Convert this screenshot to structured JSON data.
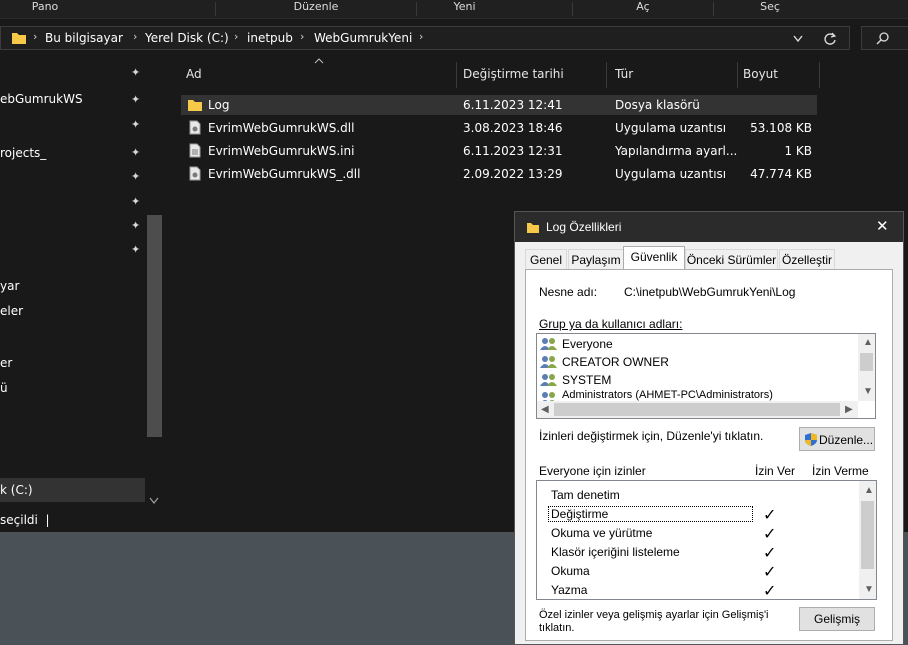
{
  "ribbon": {
    "items": [
      "Pano",
      "Düzenle",
      "Yeni",
      "Aç",
      "Seç"
    ]
  },
  "address": {
    "crumbs": [
      "Bu bilgisayar",
      "Yerel Disk (C:)",
      "inetpub",
      "WebGumrukYeni"
    ]
  },
  "nav": {
    "items": [
      "ebGumrukWS",
      "rojects_",
      "yar",
      "eler",
      "er",
      "ü",
      "k (C:)"
    ]
  },
  "columns": {
    "name": "Ad",
    "date": "Değiştirme tarihi",
    "type": "Tür",
    "size": "Boyut"
  },
  "files": [
    {
      "name": "Log",
      "date": "6.11.2023 12:41",
      "type": "Dosya klasörü",
      "size": "",
      "icon": "folder-icon"
    },
    {
      "name": "EvrimWebGumrukWS.dll",
      "date": "3.08.2023 18:46",
      "type": "Uygulama uzantısı",
      "size": "53.108 KB",
      "icon": "dll-file-icon"
    },
    {
      "name": "EvrimWebGumrukWS.ini",
      "date": "6.11.2023 12:31",
      "type": "Yapılandırma ayarl...",
      "size": "1 KB",
      "icon": "ini-file-icon"
    },
    {
      "name": "EvrimWebGumrukWS_.dll",
      "date": "2.09.2022 13:29",
      "type": "Uygulama uzantısı",
      "size": "47.774 KB",
      "icon": "dll-file-icon"
    }
  ],
  "status": {
    "text": "seçildi  |"
  },
  "dialog": {
    "title": "Log Özellikleri",
    "tabs": [
      "Genel",
      "Paylaşım",
      "Güvenlik",
      "Önceki Sürümler",
      "Özelleştir"
    ],
    "active_tab": "Güvenlik",
    "object_label": "Nesne adı:",
    "object_value": "C:\\inetpub\\WebGumrukYeni\\Log",
    "group_label": "Grup ya da kullanıcı adları:",
    "users": [
      "Everyone",
      "CREATOR OWNER",
      "SYSTEM",
      "Administrators (AHMET-PC\\Administrators)"
    ],
    "edit_hint": "İzinleri değiştirmek için, Düzenle'yi tıklatın.",
    "edit_button": "Düzenle...",
    "perm_label": "Everyone için izinler",
    "allow_label": "İzin Ver",
    "deny_label": "İzin Verme",
    "permissions": [
      {
        "name": "Tam denetim",
        "allow": false
      },
      {
        "name": "Değiştirme",
        "allow": true
      },
      {
        "name": "Okuma ve yürütme",
        "allow": true
      },
      {
        "name": "Klasör içeriğini listeleme",
        "allow": true
      },
      {
        "name": "Okuma",
        "allow": true
      },
      {
        "name": "Yazma",
        "allow": true
      }
    ],
    "advanced_hint_1": "Özel izinler veya gelişmiş ayarlar için Gelişmiş'i",
    "advanced_hint_2": "tıklatın.",
    "advanced_button": "Gelişmiş",
    "checkmark": "✓",
    "close_glyph": "✕"
  },
  "colors": {
    "explorer_bg": "#191919",
    "selected_row": "#333333",
    "folder_yellow": "#f7c948",
    "dialog_bg": "#f0f0f0",
    "taskbar_area": "#4a5258"
  }
}
